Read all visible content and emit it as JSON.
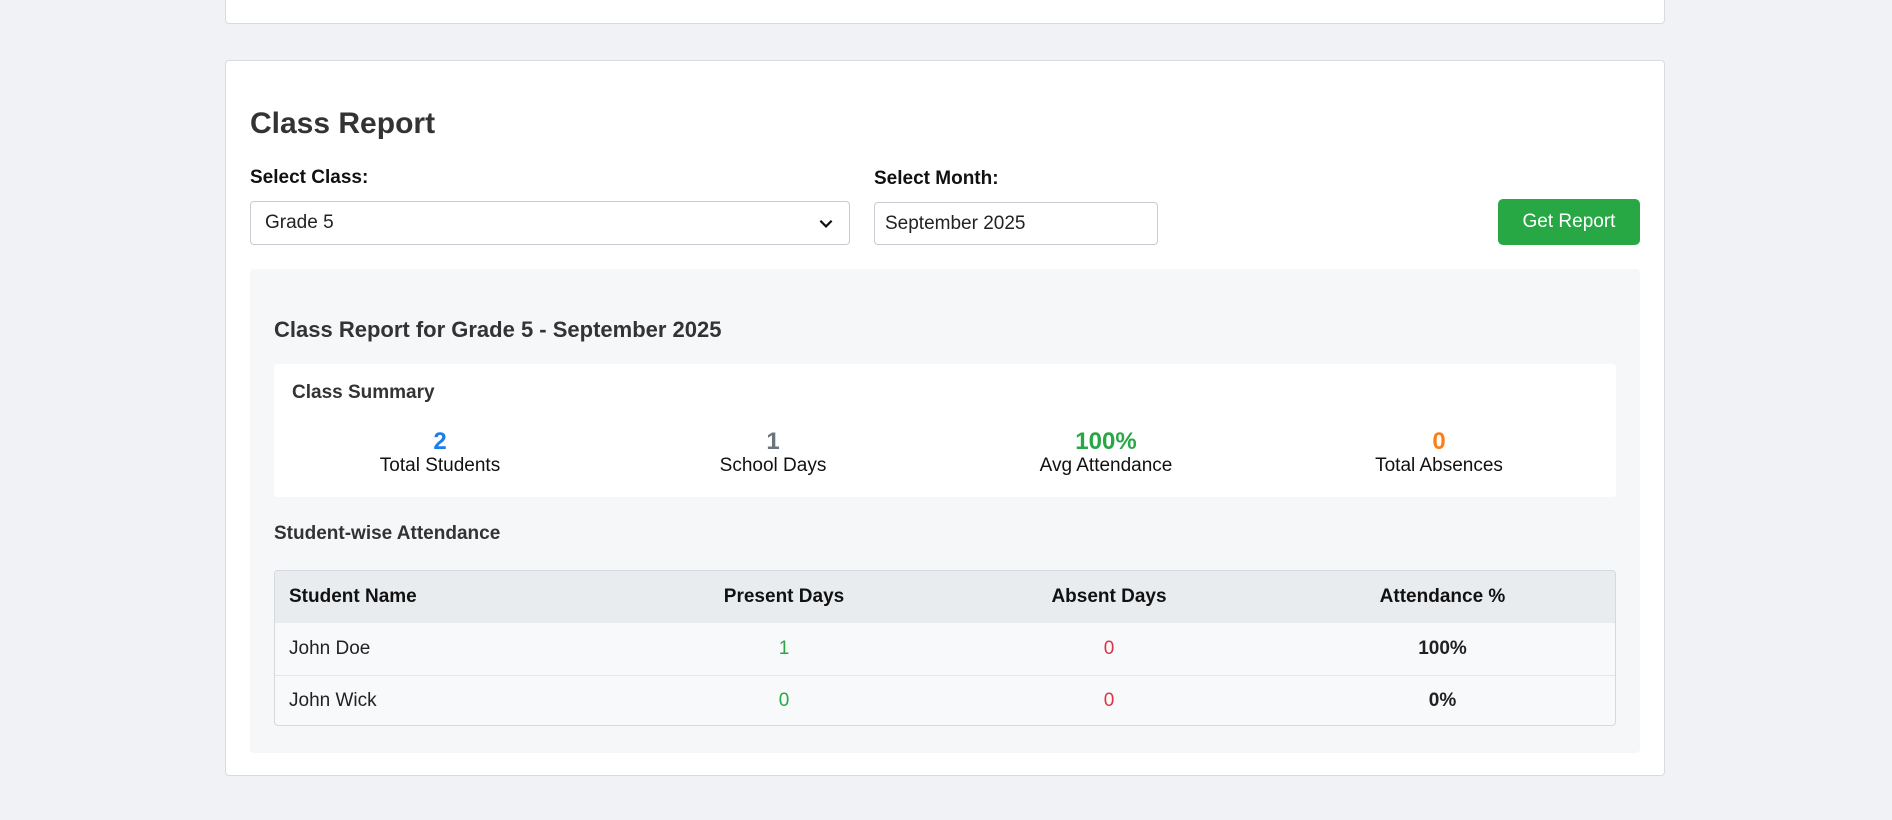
{
  "page": {
    "title": "Class Report"
  },
  "form": {
    "class_label": "Select Class:",
    "class_value": "Grade 5",
    "month_label": "Select Month:",
    "month_value": "September 2025",
    "submit_label": "Get Report"
  },
  "report": {
    "heading": "Class Report for Grade 5 - September 2025",
    "summary": {
      "title": "Class Summary",
      "stats": [
        {
          "value": "2",
          "label": "Total Students",
          "color": "#1a7fe8"
        },
        {
          "value": "1",
          "label": "School Days",
          "color": "#6c757d"
        },
        {
          "value": "100%",
          "label": "Avg Attendance",
          "color": "#28a745"
        },
        {
          "value": "0",
          "label": "Total Absences",
          "color": "#fd7e14"
        }
      ]
    },
    "attendance": {
      "title": "Student-wise Attendance",
      "columns": [
        "Student Name",
        "Present Days",
        "Absent Days",
        "Attendance %"
      ],
      "rows": [
        {
          "name": "John Doe",
          "present": "1",
          "absent": "0",
          "percent": "100%"
        },
        {
          "name": "John Wick",
          "present": "0",
          "absent": "0",
          "percent": "0%"
        }
      ]
    }
  },
  "colors": {
    "accent_button": "#28a745",
    "present": "#28a745",
    "absent": "#dc3545"
  },
  "icons": {
    "select_chevron": "chevron-down-icon"
  }
}
